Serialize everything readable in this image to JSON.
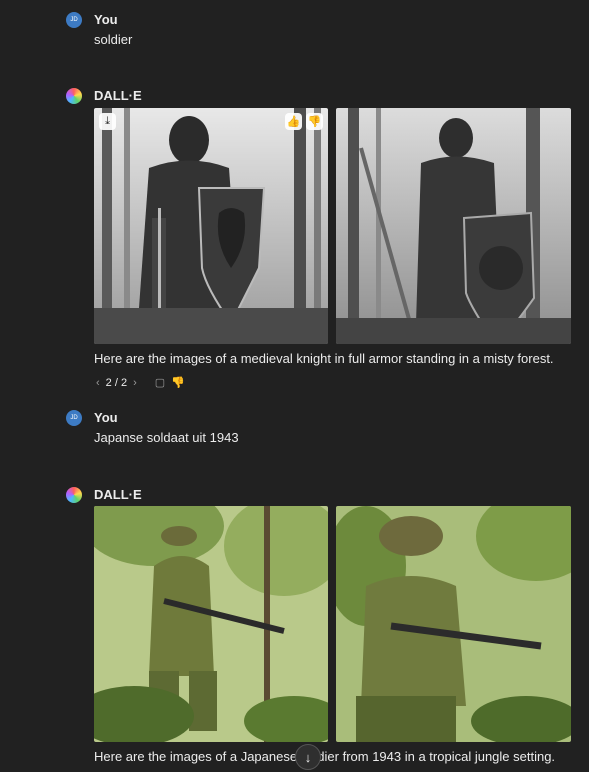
{
  "conversation": [
    {
      "author": "You",
      "avatar_initials": "JD",
      "text": "soldier"
    },
    {
      "author": "DALL·E",
      "caption": "Here are the images of a medieval knight in full armor standing in a misty forest.",
      "pager": "2 / 2"
    },
    {
      "author": "You",
      "avatar_initials": "JD",
      "text": "Japanse soldaat uit 1943"
    },
    {
      "author": "DALL·E",
      "caption": "Here are the images of a Japanese soldier from 1943 in a tropical jungle setting."
    }
  ],
  "icons": {
    "download": "⤓",
    "thumbs_up": "👍",
    "thumbs_down": "👎",
    "prev": "‹",
    "next": "›",
    "copy": "▢",
    "scroll_down": "↓"
  },
  "colors": {
    "background": "#212121",
    "user_avatar": "#3d7bc4",
    "text": "#ececec",
    "muted": "#9b9b9b"
  }
}
